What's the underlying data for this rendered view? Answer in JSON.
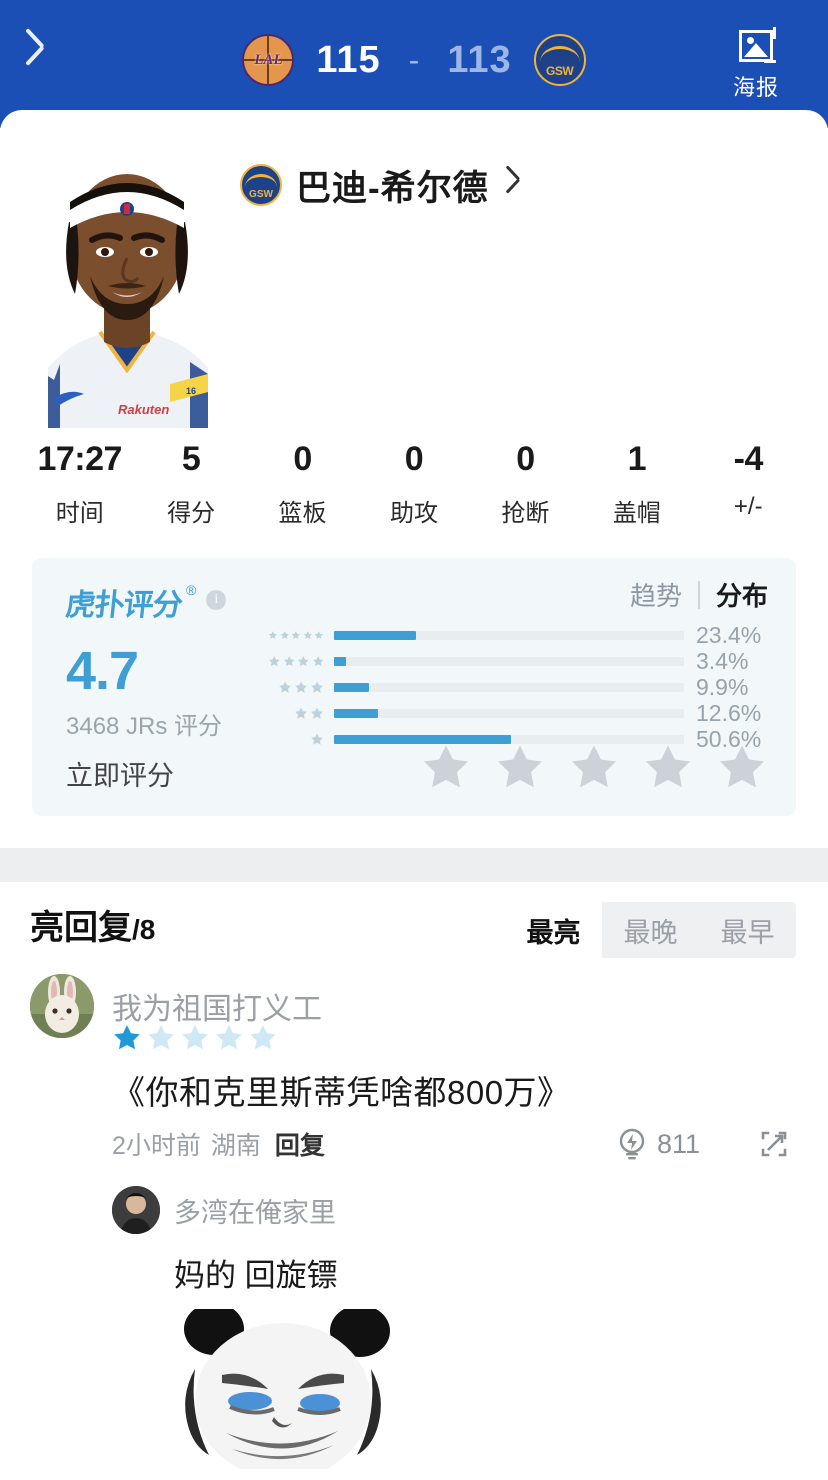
{
  "header": {
    "back_icon": "chevron-left-icon",
    "home_team": "LAL",
    "away_team": "GSW",
    "home_score": "115",
    "dash": "-",
    "away_score": "113",
    "poster_label": "海报",
    "poster_icon": "image-icon",
    "bg_color": "#1b4fb5"
  },
  "player": {
    "team_badge": "GSW",
    "name": "巴迪-希尔德",
    "chevron_icon": "chevron-right-icon",
    "stats": [
      {
        "value": "17:27",
        "label": "时间"
      },
      {
        "value": "5",
        "label": "得分"
      },
      {
        "value": "0",
        "label": "篮板"
      },
      {
        "value": "0",
        "label": "助攻"
      },
      {
        "value": "0",
        "label": "抢断"
      },
      {
        "value": "1",
        "label": "盖帽"
      },
      {
        "value": "-4",
        "label": "+/-"
      }
    ]
  },
  "rating": {
    "brand": "虎扑评分",
    "registered_mark": "®",
    "info_icon": "info-icon",
    "score": "4.7",
    "voters": "3468 JRs 评分",
    "tabs": [
      {
        "label": "趋势",
        "active": false
      },
      {
        "label": "分布",
        "active": true
      }
    ],
    "separator": "|",
    "rate_now_label": "立即评分",
    "rate_stars": 5,
    "rate_stars_filled": 0,
    "accent_color": "#3f9fd4",
    "card_bg": "#f2f7fa",
    "chart_data": {
      "type": "bar",
      "title": "虎扑评分分布",
      "categories": [
        "5星",
        "4星",
        "3星",
        "2星",
        "1星"
      ],
      "star_counts": [
        5,
        4,
        3,
        2,
        1
      ],
      "values": [
        23.4,
        3.4,
        9.9,
        12.6,
        50.6
      ],
      "labels": [
        "23.4%",
        "3.4%",
        "9.9%",
        "12.6%",
        "50.6%"
      ],
      "xlabel": "",
      "ylabel": "",
      "xlim": [
        0,
        100
      ],
      "orientation": "horizontal",
      "grid": false,
      "legend": "none",
      "bar_color": "#3f9fd4",
      "track_color": "#e8edf0"
    }
  },
  "comments": {
    "heading": "亮回复",
    "count": "/8",
    "tabs": [
      {
        "label": "最亮",
        "active": true
      },
      {
        "label": "最晚",
        "active": false
      },
      {
        "label": "最早",
        "active": false
      }
    ],
    "items": [
      {
        "user": "我为祖国打义工",
        "avatar_icon": "rabbit-avatar",
        "stars_total": 5,
        "stars_filled": 1,
        "text": "《你和克里斯蒂凭啥都800万》",
        "time": "2小时前",
        "location": "湖南",
        "reply_label": "回复",
        "like_icon": "lightbulb-icon",
        "like_count": "811",
        "share_icon": "share-icon",
        "reply": {
          "user": "多湾在俺家里",
          "avatar_icon": "person-avatar",
          "text": "妈的 回旋镖",
          "image_icon": "panda-meme-image"
        }
      }
    ]
  }
}
